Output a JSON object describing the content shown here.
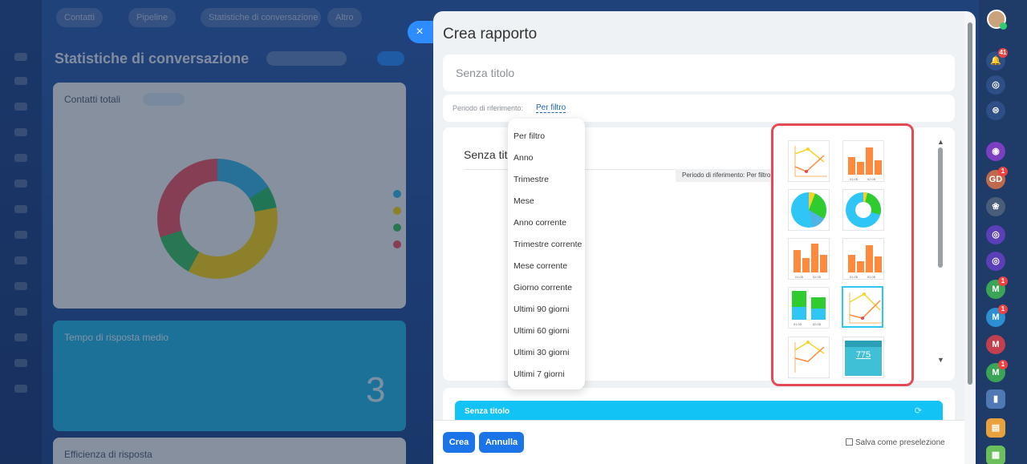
{
  "background": {
    "tabs": [
      "Contatti",
      "Pipeline",
      "Statistiche di conversazione",
      "Altro"
    ],
    "page_title": "Statistiche di conversazione",
    "cards": [
      "Contatti totali",
      "Tempo di risposta medio",
      "Efficienza di risposta"
    ],
    "big_number": "3"
  },
  "slider": {
    "title": "Crea rapporto",
    "name_placeholder": "Senza titolo",
    "period_label": "Periodo di riferimento:",
    "period_value": "Per filtro",
    "preview_title": "Senza tito",
    "preview_tooltip": "Periodo di riferimento: Per filtro",
    "period_options": [
      "Per filtro",
      "Anno",
      "Trimestre",
      "Mese",
      "Anno corrente",
      "Trimestre corrente",
      "Mese corrente",
      "Giorno corrente",
      "Ultimi 90 giorni",
      "Ultimi 60 giorni",
      "Ultimi 30 giorni",
      "Ultimi 7 giorni"
    ],
    "chart_types": [
      {
        "icon": "line-chart-icon"
      },
      {
        "icon": "bar-chart-icon",
        "labels": [
          "01.05",
          "02.05"
        ]
      },
      {
        "icon": "pie-chart-icon"
      },
      {
        "icon": "donut-chart-icon"
      },
      {
        "icon": "bar-chart-icon",
        "labels": [
          "01.05",
          "02.05"
        ]
      },
      {
        "icon": "bar-chart-icon",
        "labels": [
          "01.05",
          "02.05"
        ]
      },
      {
        "icon": "stacked-bar-chart-icon",
        "labels": [
          "01.05",
          "02.05"
        ]
      },
      {
        "icon": "line-chart-icon",
        "selected": true
      },
      {
        "icon": "line-chart-icon"
      },
      {
        "icon": "number-widget-icon",
        "value": "775"
      }
    ],
    "secondary_widget_title": "Senza titolo",
    "buttons": {
      "create": "Crea",
      "cancel": "Annulla"
    },
    "save_preset": "Salva come preselezione",
    "close_symbol": "×"
  },
  "rightbar": {
    "notification_count": "41",
    "avatars": [
      {
        "initials": "GD",
        "badge": "1",
        "color": "#c06a4d"
      },
      {
        "initials": "M",
        "badge": "1",
        "color": "#3aa655"
      },
      {
        "initials": "M",
        "badge": "1",
        "color": "#2b8fd1"
      },
      {
        "initials": "M",
        "badge": "",
        "color": "#c2404d"
      },
      {
        "initials": "M",
        "badge": "1",
        "color": "#3aa655"
      }
    ]
  },
  "colors": {
    "accent": "#2d8cff",
    "highlight_border": "#e34b54",
    "widget_header": "#12c3f5",
    "bar_orange": "#ff8a3d",
    "pie_teal": "#2fc6f6",
    "pie_green": "#2ecc2e",
    "pie_yellow": "#f5d327"
  }
}
